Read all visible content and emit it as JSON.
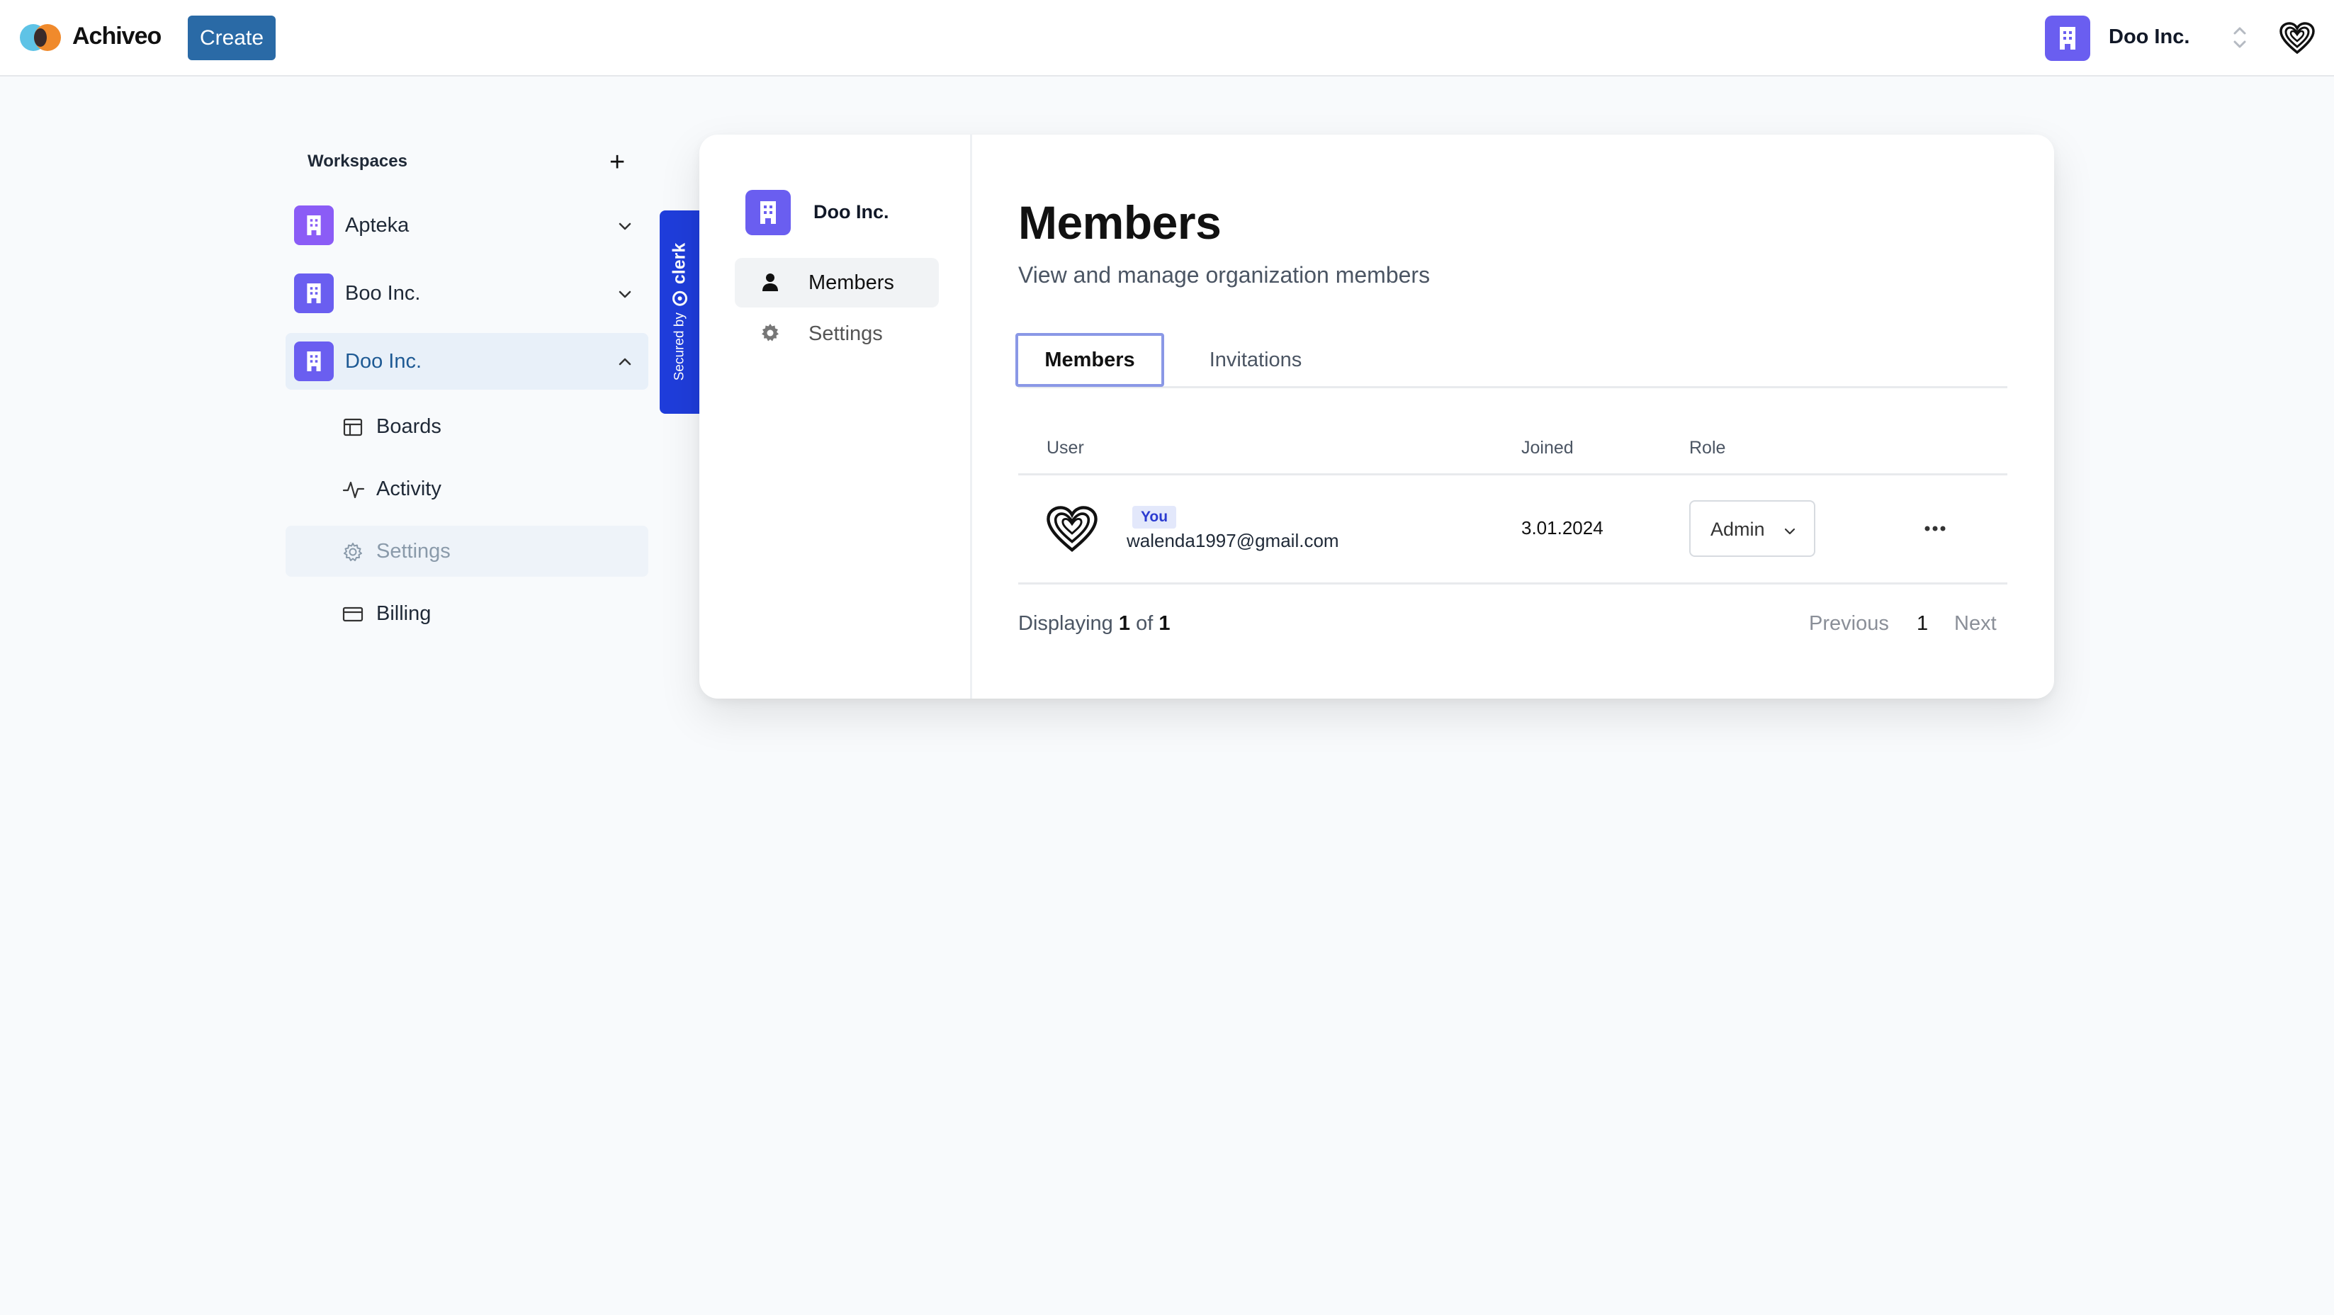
{
  "navbar": {
    "brand": "Achiveo",
    "create_label": "Create",
    "org_name": "Doo Inc."
  },
  "sidebar": {
    "title": "Workspaces",
    "add_label": "+",
    "workspaces": [
      {
        "label": "Apteka",
        "color": "#8b5cf6",
        "expanded": false
      },
      {
        "label": "Boo Inc.",
        "color": "#6a5ef0",
        "expanded": false
      },
      {
        "label": "Doo Inc.",
        "color": "#6a5ef0",
        "expanded": true
      }
    ],
    "sub_items": [
      {
        "label": "Boards",
        "icon": "layout-icon"
      },
      {
        "label": "Activity",
        "icon": "activity-icon"
      },
      {
        "label": "Settings",
        "icon": "gear-icon"
      },
      {
        "label": "Billing",
        "icon": "credit-card-icon"
      }
    ]
  },
  "clerk_badge": {
    "prefix": "Secured by",
    "brand": "clerk"
  },
  "card": {
    "org_name": "Doo Inc.",
    "nav": [
      {
        "label": "Members",
        "icon": "user-icon"
      },
      {
        "label": "Settings",
        "icon": "gear-icon"
      }
    ],
    "title": "Members",
    "subtitle": "View and manage organization members",
    "tabs": [
      {
        "label": "Members"
      },
      {
        "label": "Invitations"
      }
    ],
    "table": {
      "headers": [
        "User",
        "Joined",
        "Role"
      ],
      "rows": [
        {
          "badge": "You",
          "email": "walenda1997@gmail.com",
          "joined": "3.01.2024",
          "role": "Admin"
        }
      ]
    },
    "pagination": {
      "prefix": "Displaying",
      "current": "1",
      "of_label": "of",
      "total": "1",
      "prev_label": "Previous",
      "page": "1",
      "next_label": "Next"
    }
  },
  "colors": {
    "accent": "#2a6aa6",
    "org_avatar": "#6a5ef0",
    "clerk_blue": "#1f3ddb"
  }
}
